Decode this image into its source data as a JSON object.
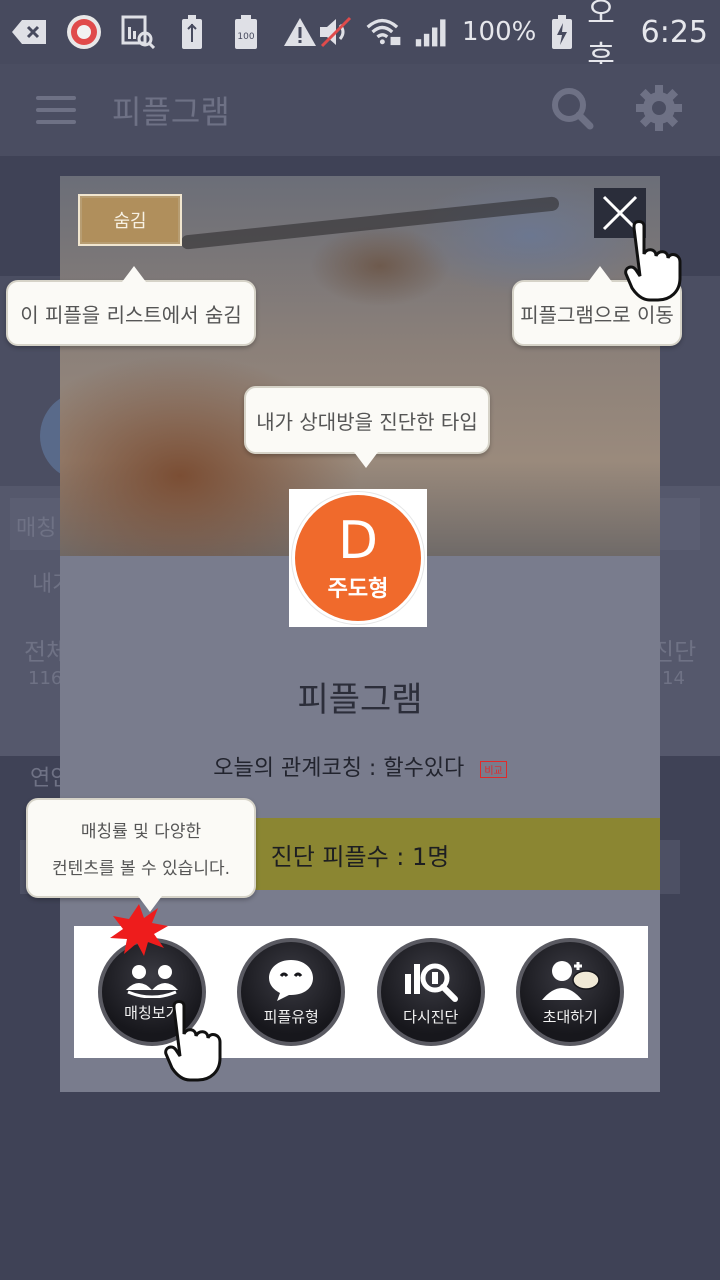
{
  "status_bar": {
    "battery_percent": "100%",
    "period": "오후",
    "time": "6:25"
  },
  "app_bar": {
    "title": "피플그램"
  },
  "background": {
    "row_label_partial": "내가",
    "stat_left_label": "전체",
    "stat_left_value": "116",
    "stat_right_label": "진단",
    "stat_right_value": "14",
    "search_partial": "매칭",
    "section_partial": "연인"
  },
  "modal": {
    "hide_label": "숨김",
    "avatar_letter": "D",
    "avatar_type": "주도형",
    "title": "피플그램",
    "coaching_text": "오늘의 관계코칭 : 할수있다",
    "coaching_tag": "비교",
    "diagnosis_count": "진단 피플수 : 1명",
    "buttons": [
      {
        "label": "매칭보기",
        "icon": "matching-people-icon"
      },
      {
        "label": "피플유형",
        "icon": "speech-bubble-smile-icon"
      },
      {
        "label": "다시진단",
        "icon": "chart-magnifier-icon"
      },
      {
        "label": "초대하기",
        "icon": "person-talk-icon"
      }
    ]
  },
  "tooltips": {
    "hide": "이 피플을 리스트에서 숨김",
    "goto": "피플그램으로 이동",
    "type": "내가 상대방을 진단한 타입",
    "matching_line1": "매칭률 및 다양한",
    "matching_line2": "컨텐츠를 볼 수 있습니다."
  }
}
